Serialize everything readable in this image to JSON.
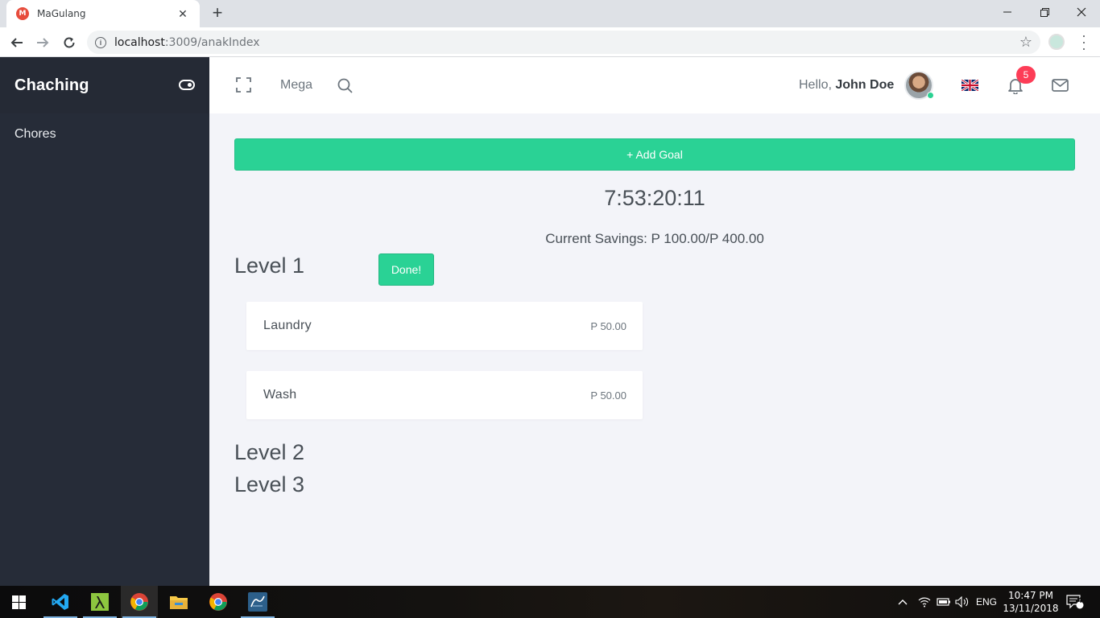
{
  "browser": {
    "tab_title": "MaGulang",
    "favicon_letter": "M",
    "url_host": "localhost",
    "url_path": ":3009/anakIndex"
  },
  "sidebar": {
    "brand": "Chaching",
    "items": [
      {
        "label": "Chores"
      }
    ]
  },
  "topbar": {
    "mega_label": "Mega",
    "hello_prefix": "Hello,",
    "user_name": "John Doe",
    "notification_count": "5"
  },
  "main": {
    "add_goal_label": "+ Add Goal",
    "timer": "7:53:20:11",
    "savings": "Current Savings: P 100.00/P 400.00",
    "done_label": "Done!",
    "levels": [
      {
        "label": "Level 1"
      },
      {
        "label": "Level 2"
      },
      {
        "label": "Level 3"
      }
    ],
    "chores": [
      {
        "name": "Laundry",
        "amount": "P 50.00"
      },
      {
        "name": "Wash",
        "amount": "P 50.00"
      }
    ]
  },
  "taskbar": {
    "language": "ENG",
    "time": "10:47 PM",
    "date": "13/11/2018",
    "notifications": "4"
  },
  "colors": {
    "accent_green": "#2ad295",
    "sidebar_bg": "#262c38",
    "badge_red": "#fd3d57",
    "content_bg": "#f3f4f9"
  }
}
